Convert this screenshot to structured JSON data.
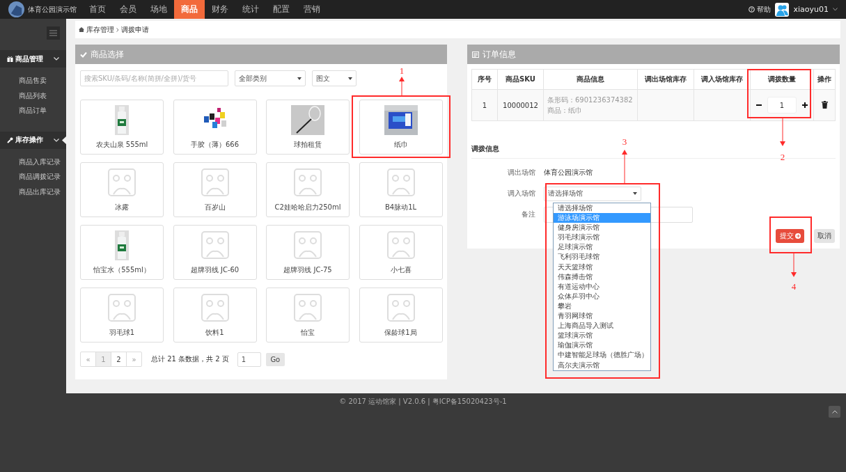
{
  "header": {
    "logo_text": "体育公园演示馆",
    "nav": [
      {
        "label": "首页",
        "selected": false
      },
      {
        "label": "会员",
        "selected": false
      },
      {
        "label": "场地",
        "selected": false
      },
      {
        "label": "商品",
        "selected": true
      },
      {
        "label": "财务",
        "selected": false
      },
      {
        "label": "统计",
        "selected": false
      },
      {
        "label": "配置",
        "selected": false
      },
      {
        "label": "营销",
        "selected": false
      }
    ],
    "help": "帮助",
    "user": "xiaoyu01"
  },
  "sidebar": {
    "groups": [
      {
        "title": "商品管理",
        "active": false,
        "items": [
          "商品售卖",
          "商品列表",
          "商品订单"
        ]
      },
      {
        "title": "库存操作",
        "active": true,
        "items": [
          "商品入库记录",
          "商品调拨记录",
          "商品出库记录"
        ]
      }
    ]
  },
  "breadcrumb": [
    "库存管理",
    "调拨申请"
  ],
  "goods_panel": {
    "title": "商品选择",
    "search_placeholder": "搜索SKU/条码/名称(简拼/全拼)/货号",
    "category": "全部类别",
    "view": "图文",
    "products": [
      {
        "name": "农夫山泉 555ml",
        "kind": "bottle"
      },
      {
        "name": "手胶（薄）666",
        "kind": "grips"
      },
      {
        "name": "球拍租赁",
        "kind": "racket"
      },
      {
        "name": "纸巾",
        "kind": "tissue"
      },
      {
        "name": "冰露",
        "kind": "placeholder"
      },
      {
        "name": "百岁山",
        "kind": "placeholder"
      },
      {
        "name": "C2娃哈哈启力250ml",
        "kind": "placeholder"
      },
      {
        "name": "B4脉动1L",
        "kind": "placeholder"
      },
      {
        "name": "怡宝水（555ml）",
        "kind": "bottle"
      },
      {
        "name": "超牌羽线 JC-60",
        "kind": "placeholder"
      },
      {
        "name": "超牌羽线 JC-75",
        "kind": "placeholder"
      },
      {
        "name": "小七喜",
        "kind": "placeholder"
      },
      {
        "name": "羽毛球1",
        "kind": "placeholder"
      },
      {
        "name": "饮料1",
        "kind": "placeholder"
      },
      {
        "name": "怡宝",
        "kind": "placeholder"
      },
      {
        "name": "保龄球1局",
        "kind": "placeholder"
      }
    ],
    "pagination": {
      "prev": "«",
      "pages": [
        {
          "label": "1",
          "selected": true
        },
        {
          "label": "2",
          "selected": false
        }
      ],
      "next": "»",
      "summary": "总计 21 条数据，共 2 页",
      "page_input": "1",
      "go": "Go"
    }
  },
  "order_panel": {
    "title": "订单信息",
    "columns": [
      "序号",
      "商品SKU",
      "商品信息",
      "调出场馆库存",
      "调入场馆库存",
      "调拨数量",
      "操作"
    ],
    "rows": [
      {
        "no": "1",
        "sku": "10000012",
        "barcode": "条形码：6901236374382",
        "product": "商品：纸巾",
        "qty": "1"
      }
    ],
    "transfer": {
      "title": "调拨信息",
      "from_label": "调出场馆",
      "from_value": "体育公园演示馆",
      "to_label": "调入场馆",
      "to_value": "请选择场馆",
      "options": [
        {
          "label": "请选择场馆",
          "selected": false
        },
        {
          "label": "游泳场演示馆",
          "selected": true
        },
        {
          "label": "健身房演示馆",
          "selected": false
        },
        {
          "label": "羽毛球演示馆",
          "selected": false
        },
        {
          "label": "足球演示馆",
          "selected": false
        },
        {
          "label": "飞利羽毛球馆",
          "selected": false
        },
        {
          "label": "天天篮球馆",
          "selected": false
        },
        {
          "label": "伟森搏击馆",
          "selected": false
        },
        {
          "label": "有道运动中心",
          "selected": false
        },
        {
          "label": "众体乒羽中心",
          "selected": false
        },
        {
          "label": "攀岩",
          "selected": false
        },
        {
          "label": "青羽网球馆",
          "selected": false
        },
        {
          "label": "上海商品导入测试",
          "selected": false
        },
        {
          "label": "篮球演示馆",
          "selected": false
        },
        {
          "label": "瑜伽演示馆",
          "selected": false
        },
        {
          "label": "中建智能足球场（德胜广场）",
          "selected": false
        },
        {
          "label": "高尔夫演示馆",
          "selected": false
        }
      ],
      "note_label": "备注",
      "submit": "提交",
      "cancel": "取消"
    }
  },
  "footer": "© 2017 运动馆家 | V2.0.6 | 粤ICP备15020423号-1",
  "annotations": [
    {
      "label": "1"
    },
    {
      "label": "2"
    },
    {
      "label": "3"
    },
    {
      "label": "4"
    }
  ]
}
